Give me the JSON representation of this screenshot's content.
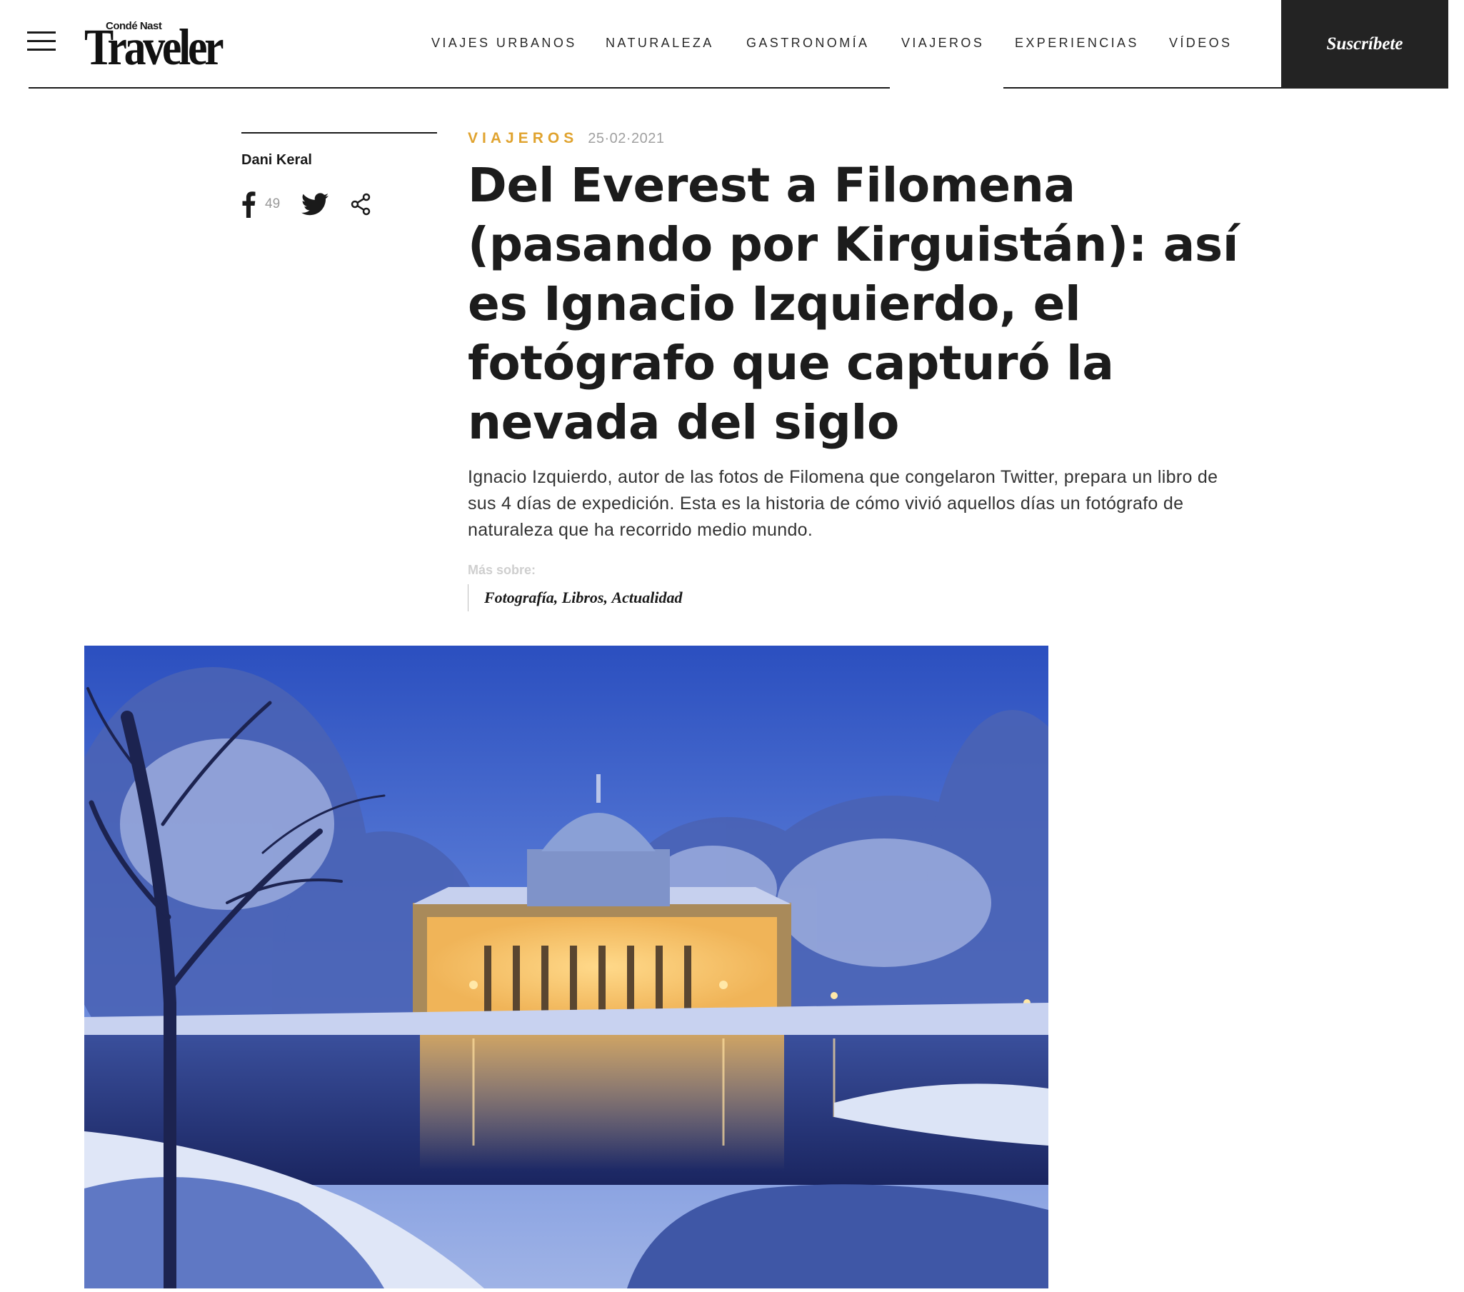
{
  "header": {
    "logo": {
      "top_text": "Condé Nast",
      "main_text": "Traveler"
    },
    "nav": [
      {
        "label": "VIAJES URBANOS"
      },
      {
        "label": "NATURALEZA"
      },
      {
        "label": "GASTRONOMÍA"
      },
      {
        "label": "VIAJEROS"
      },
      {
        "label": "EXPERIENCIAS"
      },
      {
        "label": "VÍDEOS"
      }
    ],
    "subscribe_label": "Suscríbete"
  },
  "article": {
    "author": "Dani Keral",
    "facebook_count": "49",
    "section": "VIAJEROS",
    "date": "25·02·2021",
    "title": "Del Everest a Filomena (pasando por Kirguistán): así es Ignacio Izquierdo, el fotógrafo que capturó la nevada del siglo",
    "dek": "Ignacio Izquierdo, autor de las fotos de Filomena que congelaron Twitter, prepara un libro de sus 4 días de expedición. Esta es la historia de cómo vivió aquellos días un fotógrafo de naturaleza que ha recorrido medio mundo.",
    "more_label": "Más sobre:",
    "tags": [
      "Fotografía",
      "Libros",
      "Actualidad"
    ]
  },
  "colors": {
    "accent": "#e0a32f",
    "subscribe_bg": "#232323",
    "text": "#1a1a1a"
  },
  "icons": {
    "menu": "hamburger-icon",
    "facebook": "facebook-icon",
    "twitter": "twitter-icon",
    "share": "share-icon"
  }
}
